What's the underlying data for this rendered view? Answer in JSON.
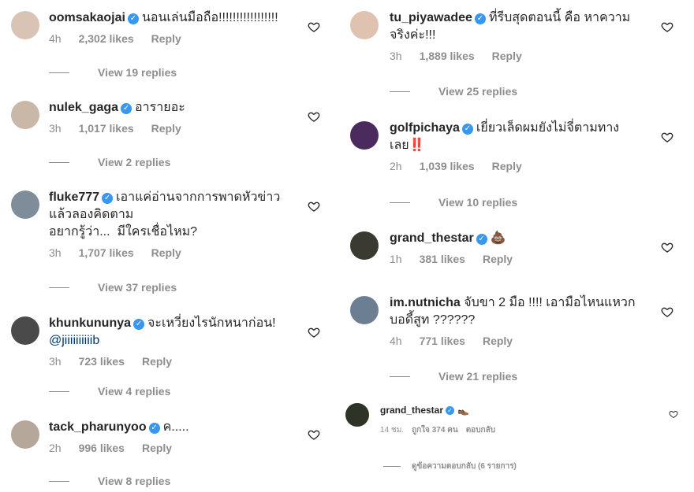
{
  "colors": {
    "text": "#262626",
    "muted": "#8e8e8e",
    "verified": "#3897f0",
    "mention": "#00376b"
  },
  "left_comments": [
    {
      "username": "oomsakaojai",
      "text": "นอนเล่นมือถือ!!!!!!!!!!!!!!!!!",
      "time": "4h",
      "likes": "2,302 likes",
      "reply": "Reply",
      "view_replies": "View 19 replies",
      "avatar_color": "#d9c3b5"
    },
    {
      "username": "nulek_gaga",
      "text": "อารายอะ",
      "time": "3h",
      "likes": "1,017 likes",
      "reply": "Reply",
      "view_replies": "View 2 replies",
      "avatar_color": "#c9b7a8"
    },
    {
      "username": "fluke777",
      "text": "เอาแค่อ่านจากการพาดหัวข่าว",
      "text2": "แล้วลองคิดตาม",
      "text3": "อยากรู้ว่า...  มีใครเชื่อไหม?",
      "time": "3h",
      "likes": "1,707 likes",
      "reply": "Reply",
      "view_replies": "View 37 replies",
      "avatar_color": "#7f8c9a"
    },
    {
      "username": "khunkununya",
      "text": "จะเหวี่ยงไรนักหนาก่อน!",
      "mention": "@jiiiiiiiiiib",
      "time": "3h",
      "likes": "723 likes",
      "reply": "Reply",
      "view_replies": "View 4 replies",
      "avatar_color": "#4a4a4a"
    },
    {
      "username": "tack_pharunyoo",
      "text": "ค.....",
      "time": "2h",
      "likes": "996 likes",
      "reply": "Reply",
      "view_replies": "View 8 replies",
      "avatar_color": "#b5a89a"
    }
  ],
  "right_comments": [
    {
      "username": "tu_piyawadee",
      "text": "ที่รีบสุดตอนนี้ คือ หาความ",
      "text2": "จริงค่ะ!!!",
      "time": "3h",
      "likes": "1,889 likes",
      "reply": "Reply",
      "view_replies": "View 25 replies",
      "avatar_color": "#e0c2b0"
    },
    {
      "username": "golfpichaya",
      "text": "เยี่ยวเล็ดผมยังไม่จี่ตามทาง",
      "text2": "เลย‼️",
      "time": "2h",
      "likes": "1,039 likes",
      "reply": "Reply",
      "view_replies": "View 10 replies",
      "avatar_color": "#4b2a5e"
    },
    {
      "username": "grand_thestar",
      "text": "💩",
      "time": "1h",
      "likes": "381 likes",
      "reply": "Reply",
      "avatar_color": "#3a3a30"
    },
    {
      "username": "im.nutnicha",
      "text": "จับขา 2 มือ !!!! เอามือไหนแหวก",
      "text2": "บอดี้สูท ??????",
      "time": "4h",
      "likes": "771 likes",
      "reply": "Reply",
      "view_replies": "View 21 replies",
      "avatar_color": "#6c7f92"
    }
  ],
  "small_comment": {
    "username": "grand_thestar",
    "text": "👞",
    "time": "14 ชม.",
    "likes": "ถูกใจ 374 คน",
    "reply": "ตอบกลับ",
    "view_replies": "ดูข้อความตอบกลับ (6 รายการ)",
    "avatar_color": "#2e3327"
  },
  "icons": {
    "heart": "heart-outline-icon",
    "verified": "verified-badge-icon"
  }
}
